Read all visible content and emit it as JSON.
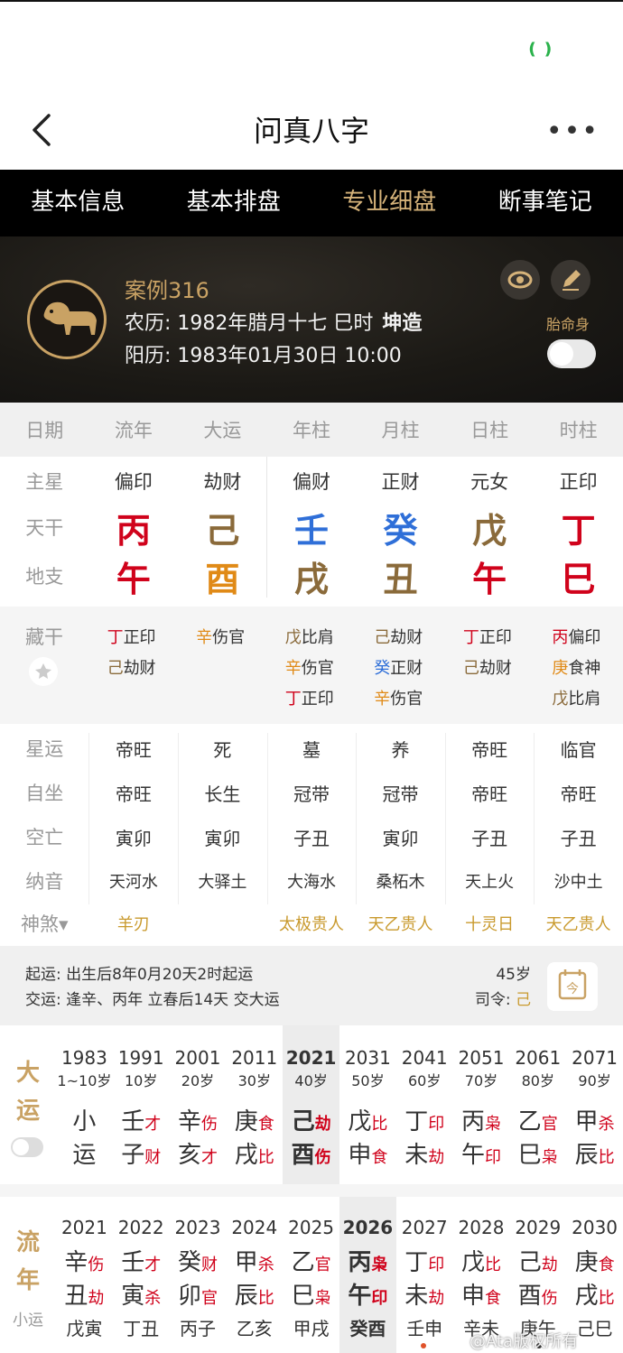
{
  "app": {
    "title": "问真八字"
  },
  "tabs": [
    {
      "label": "基本信息",
      "active": false
    },
    {
      "label": "基本排盘",
      "active": false
    },
    {
      "label": "专业细盘",
      "active": true
    },
    {
      "label": "断事笔记",
      "active": false
    }
  ],
  "profile": {
    "case_name": "案例316",
    "lunar_prefix": "农历:",
    "lunar_date": "1982年腊月十七 巳时",
    "gender_tag": "坤造",
    "solar_prefix": "阳历:",
    "solar_date": "1983年01月30日 10:00",
    "taiyuan_label": "胎命身"
  },
  "header": [
    "日期",
    "流年",
    "大运",
    "年柱",
    "月柱",
    "日柱",
    "时柱"
  ],
  "labels": {
    "zhuxing": "主星",
    "tiangan": "天干",
    "dizhi": "地支",
    "canggan": "藏干",
    "xingyun": "星运",
    "zizuo": "自坐",
    "kongwang": "空亡",
    "nayin": "纳音",
    "shensha": "神煞▾"
  },
  "zhuxing": [
    "偏印",
    "劫财",
    "偏财",
    "正财",
    "元女",
    "正印"
  ],
  "tiangan": [
    {
      "c": "丙",
      "color": "#d0021b"
    },
    {
      "c": "己",
      "color": "#8a6a3a"
    },
    {
      "c": "壬",
      "color": "#2f6fd8"
    },
    {
      "c": "癸",
      "color": "#2f6fd8"
    },
    {
      "c": "戊",
      "color": "#8a6a3a"
    },
    {
      "c": "丁",
      "color": "#d0021b"
    }
  ],
  "dizhi": [
    {
      "c": "午",
      "color": "#d0021b"
    },
    {
      "c": "酉",
      "color": "#e08a17"
    },
    {
      "c": "戌",
      "color": "#8a6a3a"
    },
    {
      "c": "丑",
      "color": "#8a6a3a"
    },
    {
      "c": "午",
      "color": "#d0021b"
    },
    {
      "c": "巳",
      "color": "#d0021b"
    }
  ],
  "canggan": [
    [
      {
        "g": "丁",
        "gc": "#d0021b",
        "s": "正印"
      },
      {
        "g": "己",
        "gc": "#8a6a3a",
        "s": "劫财"
      }
    ],
    [
      {
        "g": "辛",
        "gc": "#e08a17",
        "s": "伤官"
      }
    ],
    [
      {
        "g": "戊",
        "gc": "#8a6a3a",
        "s": "比肩"
      },
      {
        "g": "辛",
        "gc": "#e08a17",
        "s": "伤官"
      },
      {
        "g": "丁",
        "gc": "#d0021b",
        "s": "正印"
      }
    ],
    [
      {
        "g": "己",
        "gc": "#8a6a3a",
        "s": "劫财"
      },
      {
        "g": "癸",
        "gc": "#2f6fd8",
        "s": "正财"
      },
      {
        "g": "辛",
        "gc": "#e08a17",
        "s": "伤官"
      }
    ],
    [
      {
        "g": "丁",
        "gc": "#d0021b",
        "s": "正印"
      },
      {
        "g": "己",
        "gc": "#8a6a3a",
        "s": "劫财"
      }
    ],
    [
      {
        "g": "丙",
        "gc": "#d0021b",
        "s": "偏印"
      },
      {
        "g": "庚",
        "gc": "#e08a17",
        "s": "食神"
      },
      {
        "g": "戊",
        "gc": "#8a6a3a",
        "s": "比肩"
      }
    ]
  ],
  "xingyun": [
    "帝旺",
    "死",
    "墓",
    "养",
    "帝旺",
    "临官"
  ],
  "zizuo": [
    "帝旺",
    "长生",
    "冠带",
    "冠带",
    "帝旺",
    "帝旺"
  ],
  "kongwang": [
    "寅卯",
    "寅卯",
    "子丑",
    "寅卯",
    "子丑",
    "子丑"
  ],
  "nayin": [
    "天河水",
    "大驿土",
    "大海水",
    "桑柘木",
    "天上火",
    "沙中土"
  ],
  "shensha": [
    "羊刃",
    "",
    "太极贵人",
    "天乙贵人",
    "十灵日",
    "天乙贵人"
  ],
  "info": {
    "qiyun": "起运: 出生后8年0月20天2时起运",
    "jiaoyun": "交运: 逢辛、丙年 立春后14天 交大运",
    "age": "45岁",
    "siling_label": "司令:",
    "siling_value": "己"
  },
  "dayun": {
    "label_top": "大",
    "label_bottom": "运",
    "columns": [
      {
        "year": "1983",
        "age": "1~10岁",
        "xiao": [
          "小",
          "运"
        ]
      },
      {
        "year": "1991",
        "age": "10岁",
        "g": "壬",
        "gs": "才",
        "z": "子",
        "zs": "财"
      },
      {
        "year": "2001",
        "age": "20岁",
        "g": "辛",
        "gs": "伤",
        "z": "亥",
        "zs": "才"
      },
      {
        "year": "2011",
        "age": "30岁",
        "g": "庚",
        "gs": "食",
        "z": "戌",
        "zs": "比"
      },
      {
        "year": "2021",
        "age": "40岁",
        "g": "己",
        "gs": "劫",
        "z": "酉",
        "zs": "伤",
        "sel": true
      },
      {
        "year": "2031",
        "age": "50岁",
        "g": "戊",
        "gs": "比",
        "z": "申",
        "zs": "食"
      },
      {
        "year": "2041",
        "age": "60岁",
        "g": "丁",
        "gs": "印",
        "z": "未",
        "zs": "劫"
      },
      {
        "year": "2051",
        "age": "70岁",
        "g": "丙",
        "gs": "枭",
        "z": "午",
        "zs": "印"
      },
      {
        "year": "2061",
        "age": "80岁",
        "g": "乙",
        "gs": "官",
        "z": "巳",
        "zs": "枭"
      },
      {
        "year": "2071",
        "age": "90岁",
        "g": "甲",
        "gs": "杀",
        "z": "辰",
        "zs": "比"
      }
    ]
  },
  "liunian": {
    "label_top": "流",
    "label_bottom": "年",
    "label_small": "小运",
    "columns": [
      {
        "year": "2021",
        "g": "辛",
        "gs": "伤",
        "z": "丑",
        "zs": "劫",
        "x": "戊寅"
      },
      {
        "year": "2022",
        "g": "壬",
        "gs": "才",
        "z": "寅",
        "zs": "杀",
        "x": "丁丑"
      },
      {
        "year": "2023",
        "g": "癸",
        "gs": "财",
        "z": "卯",
        "zs": "官",
        "x": "丙子"
      },
      {
        "year": "2024",
        "g": "甲",
        "gs": "杀",
        "z": "辰",
        "zs": "比",
        "x": "乙亥"
      },
      {
        "year": "2025",
        "g": "乙",
        "gs": "官",
        "z": "巳",
        "zs": "枭",
        "x": "甲戌"
      },
      {
        "year": "2026",
        "g": "丙",
        "gs": "枭",
        "z": "午",
        "zs": "印",
        "x": "癸酉",
        "sel": true
      },
      {
        "year": "2027",
        "g": "丁",
        "gs": "印",
        "z": "未",
        "zs": "劫",
        "x": "壬申"
      },
      {
        "year": "2028",
        "g": "戊",
        "gs": "比",
        "z": "申",
        "zs": "食",
        "x": "辛未"
      },
      {
        "year": "2029",
        "g": "己",
        "gs": "劫",
        "z": "酉",
        "zs": "伤",
        "x": "庚午"
      },
      {
        "year": "2030",
        "g": "庚",
        "gs": "食",
        "z": "戌",
        "zs": "比",
        "x": "己巳"
      }
    ]
  },
  "watermark": "@Ata版权所有"
}
